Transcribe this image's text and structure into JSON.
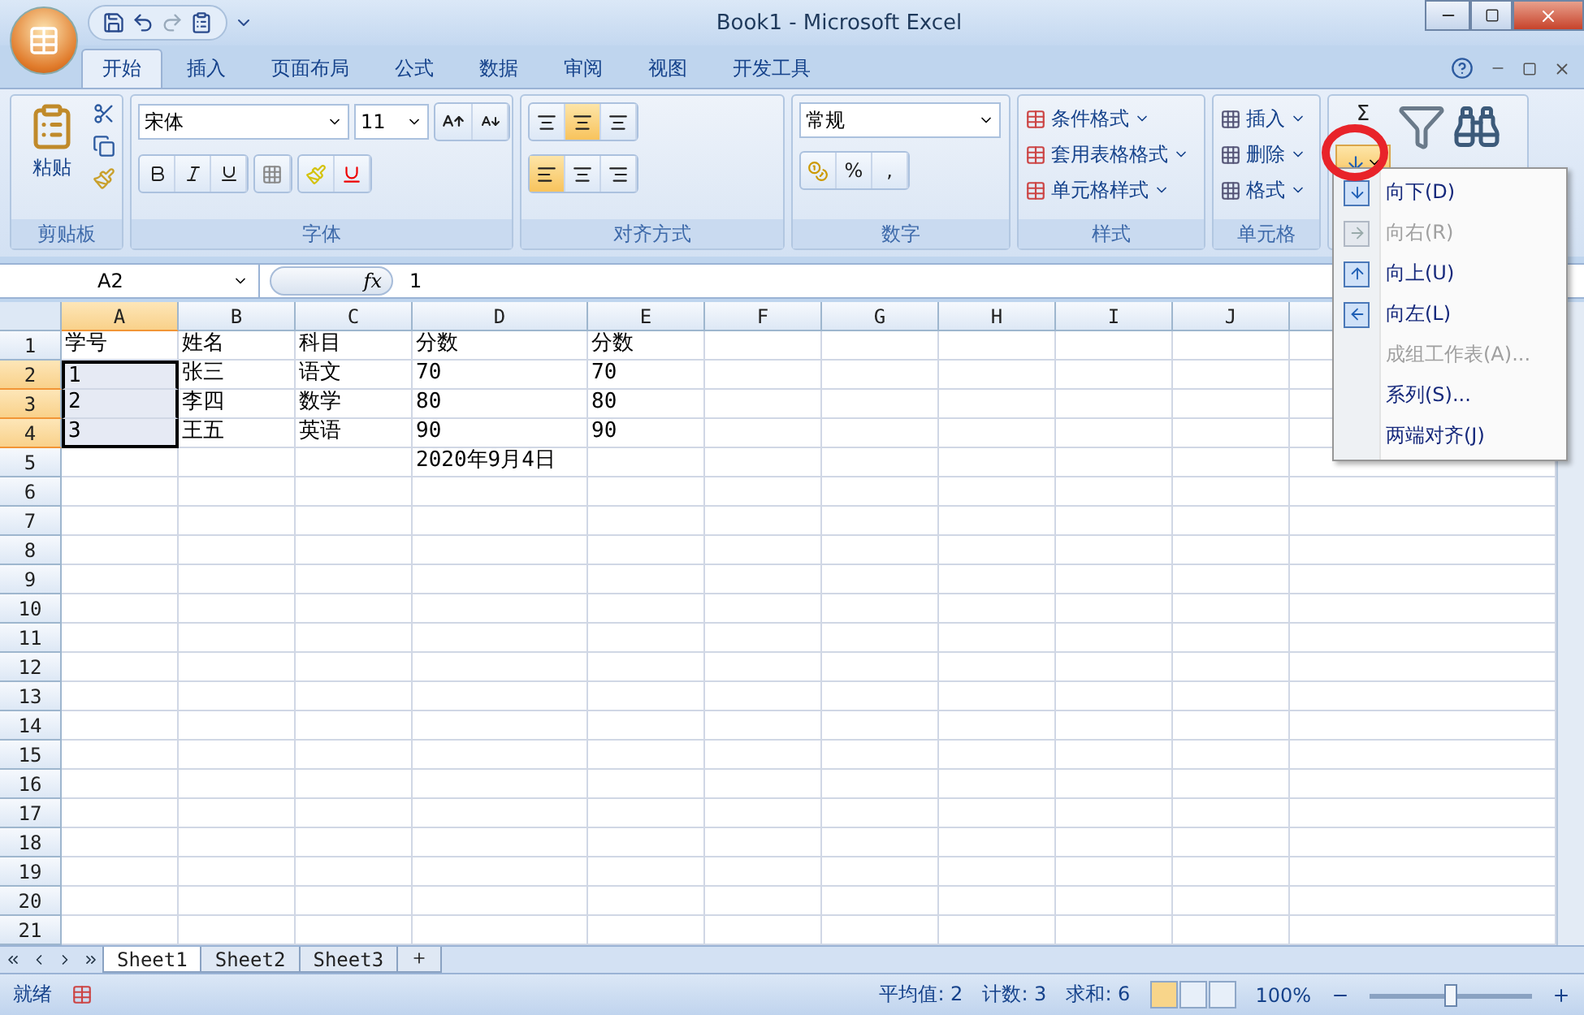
{
  "window": {
    "title": "Book1 - Microsoft Excel"
  },
  "ribbon_tabs": [
    {
      "label": "开始",
      "selected": true
    },
    {
      "label": "插入",
      "selected": false
    },
    {
      "label": "页面布局",
      "selected": false
    },
    {
      "label": "公式",
      "selected": false
    },
    {
      "label": "数据",
      "selected": false
    },
    {
      "label": "审阅",
      "selected": false
    },
    {
      "label": "视图",
      "selected": false
    },
    {
      "label": "开发工具",
      "selected": false
    }
  ],
  "ribbon": {
    "clipboard": {
      "paste": "粘贴",
      "label": "剪贴板"
    },
    "font": {
      "name": "宋体",
      "size": "11",
      "label": "字体"
    },
    "alignment": {
      "label": "对齐方式",
      "vertical": [
        {
          "selected": false
        },
        {
          "selected": true
        },
        {
          "selected": false
        }
      ],
      "horizontal": [
        {
          "selected": true
        },
        {
          "selected": false
        },
        {
          "selected": false
        }
      ]
    },
    "number": {
      "format": "常规",
      "percent": "%",
      "comma": ",",
      "label": "数字"
    },
    "styles": {
      "items": [
        "条件格式",
        "套用表格格式",
        "单元格样式"
      ],
      "label": "样式"
    },
    "cells": {
      "items": [
        "插入",
        "删除",
        "格式"
      ],
      "label": "单元格"
    },
    "editing": {
      "sum": "Σ"
    }
  },
  "formula_bar": {
    "name_box": "A2",
    "fx": "fx",
    "value": "1"
  },
  "sheet": {
    "columns": [
      {
        "label": "A",
        "selected": true
      },
      {
        "label": "B",
        "selected": false
      },
      {
        "label": "C",
        "selected": false
      },
      {
        "label": "D",
        "selected": false
      },
      {
        "label": "E",
        "selected": false
      },
      {
        "label": "F",
        "selected": false
      },
      {
        "label": "G",
        "selected": false
      },
      {
        "label": "H",
        "selected": false
      },
      {
        "label": "I",
        "selected": false
      },
      {
        "label": "J",
        "selected": false
      }
    ],
    "rows": [
      {
        "header": "1",
        "selected": false,
        "cells": {
          "A": "学号",
          "B": "姓名",
          "C": "科目",
          "D": "分数",
          "E": "分数"
        }
      },
      {
        "header": "2",
        "selected": true,
        "cells": {
          "A": "1",
          "B": "张三",
          "C": "语文",
          "D": "70",
          "E": "70"
        }
      },
      {
        "header": "3",
        "selected": true,
        "cells": {
          "A": "2",
          "B": "李四",
          "C": "数学",
          "D": "80",
          "E": "80"
        }
      },
      {
        "header": "4",
        "selected": true,
        "cells": {
          "A": "3",
          "B": "王五",
          "C": "英语",
          "D": "90",
          "E": "90"
        }
      },
      {
        "header": "5",
        "selected": false,
        "cells": {
          "D": "2020年9月4日"
        }
      },
      {
        "header": "6",
        "selected": false
      },
      {
        "header": "7",
        "selected": false
      },
      {
        "header": "8",
        "selected": false
      },
      {
        "header": "9",
        "selected": false
      },
      {
        "header": "10",
        "selected": false
      },
      {
        "header": "11",
        "selected": false
      },
      {
        "header": "12",
        "selected": false
      },
      {
        "header": "13",
        "selected": false
      },
      {
        "header": "14",
        "selected": false
      },
      {
        "header": "15",
        "selected": false
      },
      {
        "header": "16",
        "selected": false
      },
      {
        "header": "17",
        "selected": false
      },
      {
        "header": "18",
        "selected": false
      },
      {
        "header": "19",
        "selected": false
      },
      {
        "header": "20",
        "selected": false
      },
      {
        "header": "21",
        "selected": false
      }
    ]
  },
  "fill_menu": {
    "items": [
      {
        "label": "向下(D)",
        "kind": "down",
        "disabled": false
      },
      {
        "label": "向右(R)",
        "kind": "right",
        "disabled": true
      },
      {
        "label": "向上(U)",
        "kind": "up",
        "disabled": false
      },
      {
        "label": "向左(L)",
        "kind": "left",
        "disabled": false
      },
      {
        "label": "成组工作表(A)...",
        "kind": "plain",
        "disabled": true
      },
      {
        "label": "系列(S)...",
        "kind": "plain",
        "disabled": false
      },
      {
        "label": "两端对齐(J)",
        "kind": "plain",
        "disabled": false
      }
    ]
  },
  "sheet_tabs": [
    {
      "label": "Sheet1",
      "selected": true
    },
    {
      "label": "Sheet2",
      "selected": false
    },
    {
      "label": "Sheet3",
      "selected": false
    }
  ],
  "status_bar": {
    "ready": "就绪",
    "average": "平均值: 2",
    "count": "计数: 3",
    "sum": "求和: 6",
    "views": [
      {
        "selected": true
      },
      {
        "selected": false
      },
      {
        "selected": false
      }
    ],
    "zoom": "100%",
    "zoom_slider": {
      "level": 0.5
    }
  }
}
